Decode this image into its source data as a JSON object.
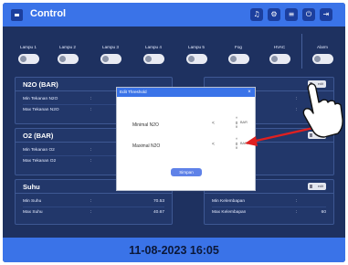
{
  "header": {
    "title": "Control",
    "icons": [
      "music-icon",
      "settings-icon",
      "list-icon",
      "power-icon",
      "logout-icon"
    ]
  },
  "toggles": [
    {
      "label": "Lampu 1"
    },
    {
      "label": "Lampu 2"
    },
    {
      "label": "Lampu 3"
    },
    {
      "label": "Lampu 4"
    },
    {
      "label": "Lampu 5"
    },
    {
      "label": "Fog"
    },
    {
      "label": "HVAC"
    },
    {
      "label": "Alarm"
    }
  ],
  "cards": {
    "n2o": {
      "title": "N2O (BAR)",
      "rows": [
        {
          "label": "Min Tekanan N2O",
          "colon": ":",
          "value": ""
        },
        {
          "label": "Max Tekanan N2O",
          "colon": ":",
          "value": ""
        }
      ]
    },
    "o2": {
      "title": "O2 (BAR)",
      "rows": [
        {
          "label": "Min Tekanan O2",
          "colon": ":",
          "value": ""
        },
        {
          "label": "Max Tekanan O2",
          "colon": ":",
          "value": ""
        }
      ]
    },
    "suhu": {
      "title": "Suhu",
      "rows": [
        {
          "label": "Min Suhu",
          "colon": ":",
          "value": "70.53"
        },
        {
          "label": "Max Suhu",
          "colon": ":",
          "value": "40.67"
        }
      ]
    },
    "kelembapan": {
      "title": "",
      "edit_label": "edit",
      "rows": [
        {
          "label": "Min Kelembapan",
          "colon": ":",
          "value": ""
        },
        {
          "label": "Max Kelembapan",
          "colon": ":",
          "value": "60"
        }
      ]
    },
    "right1": {
      "edit_label": "edit",
      "colon_a": ":",
      "colon_b": ":"
    },
    "right2": {
      "edit_label": "edit"
    }
  },
  "modal": {
    "title": "Edit Threshold",
    "close": "×",
    "fields": [
      {
        "label": "Minimal N2O",
        "value": "0",
        "unit": "BAR"
      },
      {
        "label": "Maximal N2O",
        "value": "0",
        "unit": "BAR"
      }
    ],
    "save_label": "Simpan"
  },
  "footer": {
    "datetime": "11-08-2023 16:05"
  },
  "colors": {
    "accent": "#3a73e8",
    "background": "#1e3160",
    "annotation_arrow": "#e02020"
  }
}
